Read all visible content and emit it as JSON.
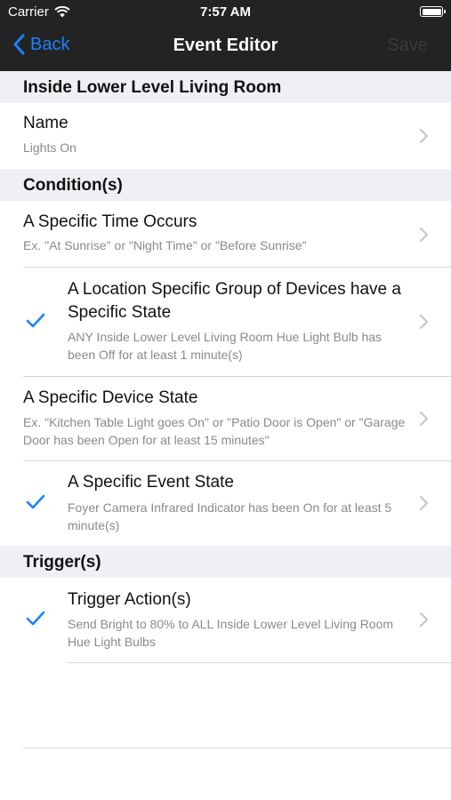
{
  "status_bar": {
    "carrier": "Carrier",
    "time": "7:57 AM"
  },
  "nav": {
    "back_label": "Back",
    "title": "Event Editor",
    "save_label": "Save"
  },
  "colors": {
    "accent": "#1a82ff",
    "bar": "#232323",
    "section_bg": "#efeff4",
    "subtitle": "#8a8a8f"
  },
  "sections": {
    "location": {
      "header": "Inside Lower Level Living Room",
      "name_row": {
        "title": "Name",
        "subtitle": "Lights On"
      }
    },
    "conditions": {
      "header": "Condition(s)",
      "items": [
        {
          "title": "A Specific Time Occurs",
          "subtitle": "Ex. \"At Sunrise\" or \"Night Time\" or \"Before Sunrise\"",
          "checked": false
        },
        {
          "title": "A Location Specific Group of Devices have a Specific State",
          "subtitle": "ANY Inside Lower Level Living Room Hue Light Bulb has been Off for at least 1 minute(s)",
          "checked": true
        },
        {
          "title": "A Specific Device State",
          "subtitle": "Ex. \"Kitchen Table Light goes On\" or \"Patio Door is Open\" or \"Garage Door has been Open for at least 15 minutes\"",
          "checked": false
        },
        {
          "title": "A Specific Event State",
          "subtitle": "Foyer Camera Infrared Indicator has been On for at least 5 minute(s)",
          "checked": true
        }
      ]
    },
    "triggers": {
      "header": "Trigger(s)",
      "items": [
        {
          "title": "Trigger Action(s)",
          "subtitle": "Send Bright to 80% to ALL Inside Lower Level Living Room Hue Light Bulbs",
          "checked": true
        }
      ]
    }
  },
  "icons": {
    "back": "chevron-left-icon",
    "disclosure": "chevron-right-icon",
    "check": "checkmark-icon",
    "wifi": "wifi-icon",
    "battery": "battery-icon"
  }
}
